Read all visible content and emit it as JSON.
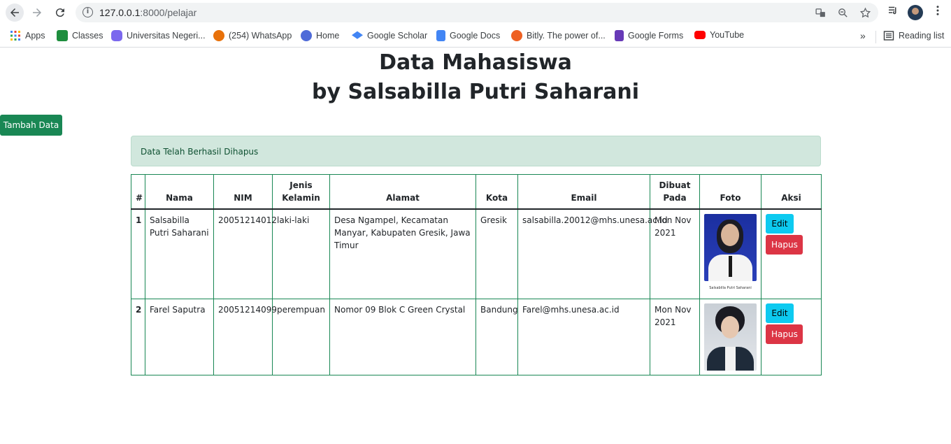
{
  "browser": {
    "url_host": "127.0.0.1",
    "url_path": ":8000/pelajar",
    "bookmarks": [
      {
        "label": "Apps",
        "color": "#ea4335"
      },
      {
        "label": "Classes",
        "color": "#1e8e3e"
      },
      {
        "label": "Universitas Negeri...",
        "color": "#7b68ee"
      },
      {
        "label": "(254) WhatsApp",
        "color": "#e8710a"
      },
      {
        "label": "Home",
        "color": "#4285f4"
      },
      {
        "label": "Google Scholar",
        "color": "#4285f4"
      },
      {
        "label": "Google Docs",
        "color": "#4285f4"
      },
      {
        "label": "Bitly. The power of...",
        "color": "#ee6123"
      },
      {
        "label": "Google Forms",
        "color": "#673ab7"
      },
      {
        "label": "YouTube",
        "color": "#ff0000"
      }
    ],
    "more": "»",
    "reading_list": "Reading list"
  },
  "page": {
    "title_line1": "Data Mahasiswa",
    "title_line2": "by Salsabilla Putri Saharani",
    "add_button": "Tambah Data",
    "alert": "Data Telah Berhasil Dihapus"
  },
  "table": {
    "headers": [
      "#",
      "Nama",
      "NIM",
      "Jenis Kelamin",
      "Alamat",
      "Kota",
      "Email",
      "Dibuat Pada",
      "Foto",
      "Aksi"
    ],
    "rows": [
      {
        "no": "1",
        "nama": "Salsabilla Putri Saharani",
        "nim": "20051214012",
        "jk": "laki-laki",
        "alamat": "Desa Ngampel, Kecamatan Manyar, Kabupaten Gresik, Jawa Timur",
        "kota": "Gresik",
        "email": "salsabilla.20012@mhs.unesa.ac.id",
        "dibuat": "Mon Nov 2021",
        "photo_caption": "Salsabilla Putri Saharani",
        "edit": "Edit",
        "hapus": "Hapus"
      },
      {
        "no": "2",
        "nama": "Farel Saputra",
        "nim": "20051214099",
        "jk": "perempuan",
        "alamat": "Nomor 09 Blok C Green Crystal",
        "kota": "Bandung",
        "email": "Farel@mhs.unesa.ac.id",
        "dibuat": "Mon Nov 2021",
        "edit": "Edit",
        "hapus": "Hapus"
      }
    ]
  }
}
